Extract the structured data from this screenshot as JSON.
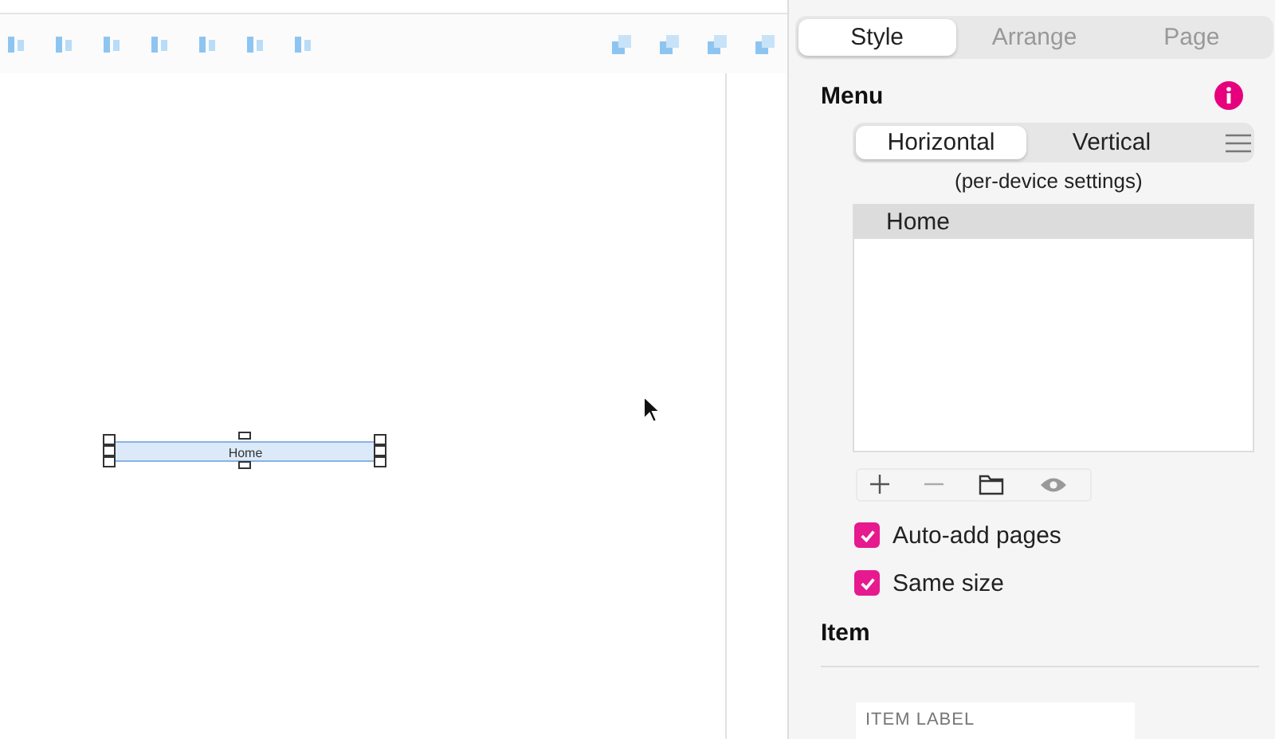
{
  "canvas": {
    "menu_element": {
      "label": "Home"
    }
  },
  "inspector": {
    "tabs": [
      {
        "label": "Style",
        "selected": true
      },
      {
        "label": "Arrange",
        "selected": false
      },
      {
        "label": "Page",
        "selected": false
      }
    ],
    "menu": {
      "title": "Menu",
      "orientation": [
        {
          "label": "Horizontal",
          "selected": true
        },
        {
          "label": "Vertical",
          "selected": false
        }
      ],
      "note": "(per-device settings)",
      "items": [
        {
          "label": "Home",
          "selected": true
        }
      ],
      "options": [
        {
          "label": "Auto-add pages",
          "checked": true
        },
        {
          "label": "Same size",
          "checked": true
        }
      ]
    },
    "item": {
      "title": "Item",
      "label_field": {
        "placeholder": "ITEM LABEL"
      }
    }
  }
}
